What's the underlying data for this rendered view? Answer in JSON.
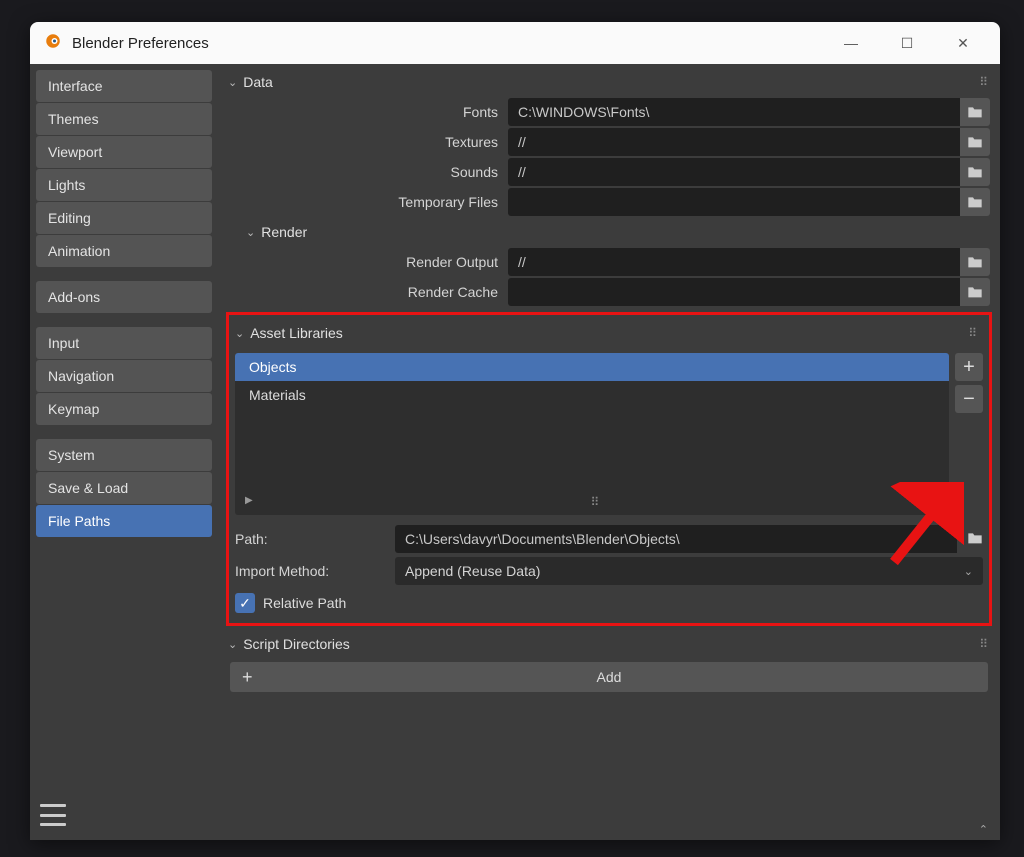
{
  "window": {
    "title": "Blender Preferences"
  },
  "sidebar": {
    "groups": [
      [
        "Interface",
        "Themes",
        "Viewport",
        "Lights",
        "Editing",
        "Animation"
      ],
      [
        "Add-ons"
      ],
      [
        "Input",
        "Navigation",
        "Keymap"
      ],
      [
        "System",
        "Save & Load",
        "File Paths"
      ]
    ],
    "active": "File Paths"
  },
  "sections": {
    "data": {
      "title": "Data"
    },
    "render": {
      "title": "Render"
    },
    "asset": {
      "title": "Asset Libraries"
    },
    "scripts": {
      "title": "Script Directories"
    }
  },
  "fields": {
    "fonts": {
      "label": "Fonts",
      "value": "C:\\WINDOWS\\Fonts\\"
    },
    "textures": {
      "label": "Textures",
      "value": "//"
    },
    "sounds": {
      "label": "Sounds",
      "value": "//"
    },
    "temp": {
      "label": "Temporary Files",
      "value": ""
    },
    "render_output": {
      "label": "Render Output",
      "value": "//"
    },
    "render_cache": {
      "label": "Render Cache",
      "value": ""
    }
  },
  "asset_libraries": {
    "items": [
      "Objects",
      "Materials"
    ],
    "selected": "Objects",
    "path_label": "Path:",
    "path_value": "C:\\Users\\davyr\\Documents\\Blender\\Objects\\",
    "import_label": "Import Method:",
    "import_value": "Append (Reuse Data)",
    "relative_label": "Relative Path",
    "relative_checked": true
  },
  "add_button": {
    "label": "Add"
  }
}
